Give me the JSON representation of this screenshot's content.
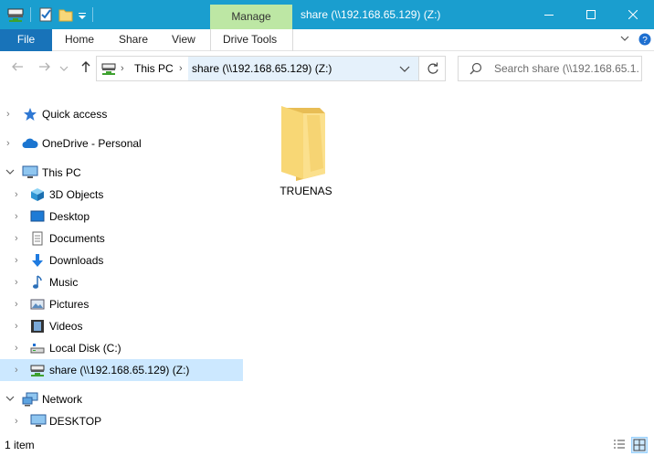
{
  "titlebar": {
    "context_tab": "Manage",
    "title": "share (\\\\192.168.65.129) (Z:)",
    "bg_color": "#1a9ecf",
    "context_tab_color": "#bde7a4"
  },
  "ribbon": {
    "file": "File",
    "tabs": [
      "Home",
      "Share",
      "View",
      "Drive Tools"
    ],
    "file_color": "#1873b9"
  },
  "address": {
    "crumbs": [
      "This PC",
      "share (\\\\192.168.65.129) (Z:)"
    ],
    "search_placeholder": "Search share (\\\\192.168.65.1..."
  },
  "nav": {
    "items": [
      {
        "label": "Quick access",
        "icon": "star-icon"
      },
      {
        "label": "OneDrive - Personal",
        "icon": "cloud-icon"
      },
      {
        "label": "This PC",
        "icon": "computer-icon"
      },
      {
        "label": "3D Objects",
        "icon": "cube-icon"
      },
      {
        "label": "Desktop",
        "icon": "desktop-icon"
      },
      {
        "label": "Documents",
        "icon": "document-icon"
      },
      {
        "label": "Downloads",
        "icon": "download-icon"
      },
      {
        "label": "Music",
        "icon": "music-icon"
      },
      {
        "label": "Pictures",
        "icon": "pictures-icon"
      },
      {
        "label": "Videos",
        "icon": "videos-icon"
      },
      {
        "label": "Local Disk (C:)",
        "icon": "disk-icon"
      },
      {
        "label": "share (\\\\192.168.65.129) (Z:)",
        "icon": "network-drive-icon"
      },
      {
        "label": "Network",
        "icon": "network-icon"
      },
      {
        "label": "DESKTOP",
        "icon": "monitor-icon"
      }
    ]
  },
  "content": {
    "items": [
      {
        "label": "TRUENAS",
        "icon": "folder-icon"
      }
    ]
  },
  "status": {
    "count": "1 item"
  }
}
